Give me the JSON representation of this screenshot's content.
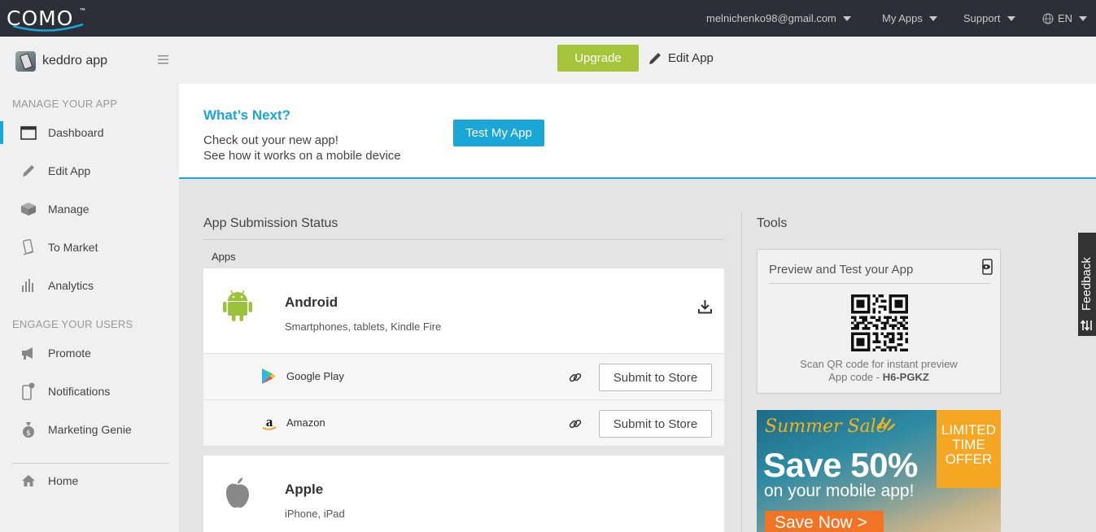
{
  "header": {
    "logo": "COMO",
    "logo_tm": "™",
    "account": "melnichenko98@gmail.com",
    "my_apps": "My Apps",
    "support": "Support",
    "language": "EN"
  },
  "sidebar": {
    "app_name": "keddro app",
    "section_manage": "MANAGE YOUR APP",
    "manage_items": [
      {
        "label": "Dashboard",
        "icon": "dashboard-icon"
      },
      {
        "label": "Edit App",
        "icon": "pencil-icon"
      },
      {
        "label": "Manage",
        "icon": "box-icon"
      },
      {
        "label": "To Market",
        "icon": "phone-market-icon"
      },
      {
        "label": "Analytics",
        "icon": "bar-chart-icon"
      }
    ],
    "section_engage": "ENGAGE YOUR USERS",
    "engage_items": [
      {
        "label": "Promote",
        "icon": "megaphone-icon"
      },
      {
        "label": "Notifications",
        "icon": "notification-phone-icon"
      },
      {
        "label": "Marketing Genie",
        "icon": "money-bag-icon"
      }
    ],
    "home": "Home"
  },
  "toolbar": {
    "upgrade": "Upgrade",
    "edit_app": "Edit App"
  },
  "banner": {
    "title": "What’s Next?",
    "line1": "Check out your new app!",
    "line2": "See how it works on a mobile device",
    "test_button": "Test My App"
  },
  "submission": {
    "title": "App Submission Status",
    "apps_label": "Apps",
    "android": {
      "name": "Android",
      "subtitle": "Smartphones, tablets, Kindle Fire"
    },
    "stores": [
      {
        "name": "Google Play",
        "button": "Submit to Store"
      },
      {
        "name": "Amazon",
        "button": "Submit to Store"
      }
    ],
    "apple": {
      "name": "Apple",
      "subtitle": "iPhone, iPad"
    }
  },
  "tools": {
    "title": "Tools",
    "preview_title": "Preview and Test your App",
    "scan_text": "Scan QR code for instant preview",
    "code_prefix": "App code -",
    "code": "H6-PGKZ"
  },
  "promo": {
    "summer": "Summer Sale",
    "save": "Save 50%",
    "on_app": "on your mobile app!",
    "badge_line1": "LIMITED",
    "badge_line2": "TIME",
    "badge_line3": "OFFER",
    "cta": "Save Now >"
  },
  "feedback": "Feedback",
  "colors": {
    "topbar": "#2c2f38",
    "accent": "#1aa6d6",
    "upgrade": "#a5c439",
    "android": "#9bc23c"
  }
}
